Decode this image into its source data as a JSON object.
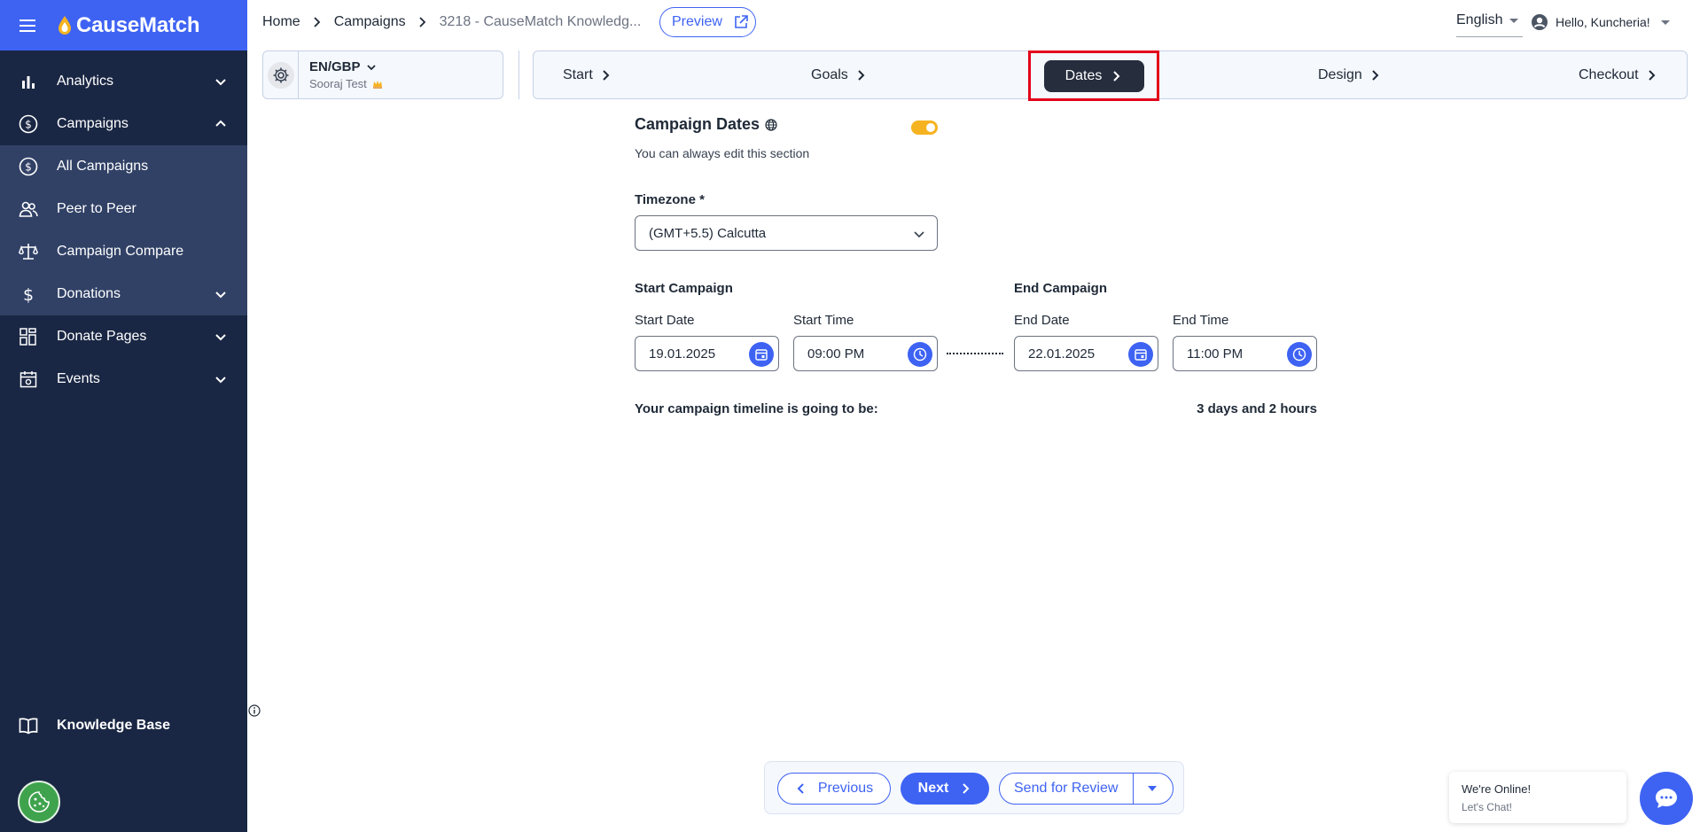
{
  "brand": {
    "name": "CauseMatch"
  },
  "sidebar": {
    "items": [
      {
        "label": "Analytics",
        "icon": "bar-chart-icon",
        "chevron": "down"
      },
      {
        "label": "Campaigns",
        "icon": "dollar-circle-icon",
        "chevron": "up"
      },
      {
        "label": "All Campaigns",
        "icon": "dollar-circle-icon"
      },
      {
        "label": "Peer to Peer",
        "icon": "people-icon"
      },
      {
        "label": "Campaign Compare",
        "icon": "scale-icon"
      },
      {
        "label": "Donations",
        "icon": "dollar-icon",
        "chevron": "down"
      },
      {
        "label": "Donate Pages",
        "icon": "grid-icon",
        "chevron": "down"
      },
      {
        "label": "Events",
        "icon": "calendar-icon",
        "chevron": "down"
      }
    ],
    "knowledge_base": "Knowledge Base"
  },
  "breadcrumb": {
    "home": "Home",
    "campaigns": "Campaigns",
    "current": "3218  -  CauseMatch Knowledg..."
  },
  "preview_label": "Preview",
  "language": "English",
  "user_greeting": "Hello, Kuncheria!",
  "locale": {
    "code": "EN/GBP",
    "org": "Sooraj Test"
  },
  "steps": [
    {
      "label": "Start"
    },
    {
      "label": "Goals"
    },
    {
      "label": "Dates",
      "active": true
    },
    {
      "label": "Design"
    },
    {
      "label": "Checkout"
    }
  ],
  "form": {
    "title": "Campaign Dates",
    "subtitle": "You can always edit this section",
    "toggle_on": true,
    "timezone_label": "Timezone *",
    "timezone_value": "(GMT+5.5) Calcutta",
    "start_group": "Start Campaign",
    "end_group": "End Campaign",
    "start_date_label": "Start Date",
    "start_date": "19.01.2025",
    "start_time_label": "Start Time",
    "start_time": "09:00 PM",
    "end_date_label": "End Date",
    "end_date": "22.01.2025",
    "end_time_label": "End Time",
    "end_time": "11:00 PM",
    "timeline_label": "Your campaign timeline is going to be:",
    "timeline_value": "3 days and 2 hours"
  },
  "actions": {
    "previous": "Previous",
    "next": "Next",
    "send_review": "Send for Review"
  },
  "chat": {
    "title": "We're Online!",
    "subtitle": "Let's Chat!"
  },
  "colors": {
    "primary": "#3e63f3",
    "sidebar": "#1a2744",
    "active_step": "#262d3d",
    "toggle": "#f6b321",
    "highlight": "#e3001b"
  }
}
